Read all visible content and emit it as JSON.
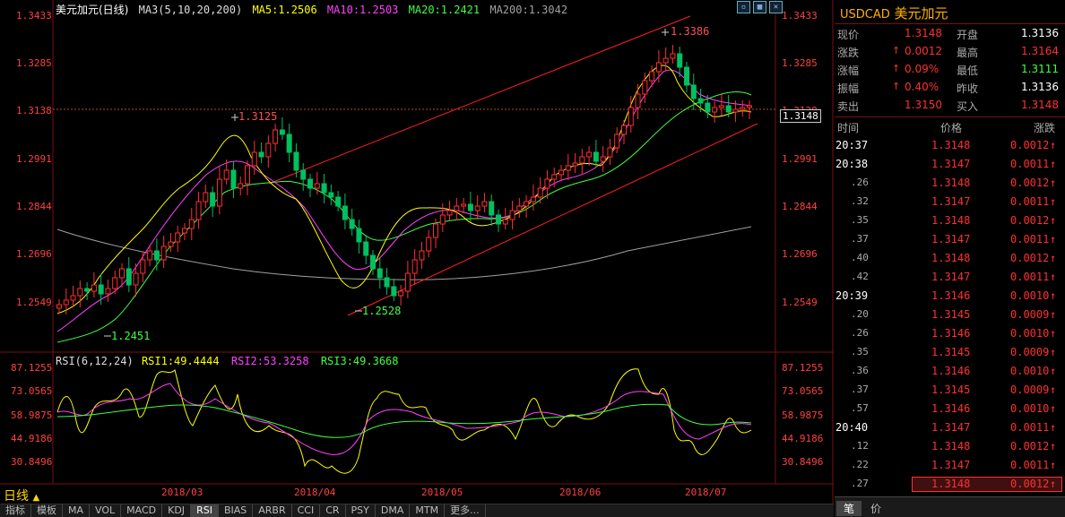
{
  "header": {
    "symbol_title": "美元加元(日线)",
    "ma_label": "MA3(5,10,20,200)",
    "ma5": "MA5:1.2506",
    "ma10": "MA10:1.2503",
    "ma20": "MA20:1.2421",
    "ma200": "MA200:1.3042",
    "colors": {
      "ma5": "#ffff00",
      "ma10": "#ff40ff",
      "ma20": "#40ff40",
      "ma200": "#a0a0a0"
    }
  },
  "price_axis": [
    "1.3433",
    "1.3285",
    "1.3138",
    "1.2991",
    "1.2844",
    "1.2696",
    "1.2549"
  ],
  "price_marker": "1.3148",
  "annotations": {
    "high1": "1.3125",
    "high2": "1.3386",
    "low1": "1.2451",
    "low2": "1.2528"
  },
  "rsi": {
    "label": "RSI(6,12,24)",
    "rsi1": "RSI1:49.4444",
    "rsi2": "RSI2:53.3258",
    "rsi3": "RSI3:49.3668",
    "axis": [
      "87.1255",
      "73.0565",
      "58.9875",
      "44.9186",
      "30.8496"
    ]
  },
  "date_axis": [
    "2018/03",
    "2018/04",
    "2018/05",
    "2018/06",
    "2018/07"
  ],
  "period_label": "日线",
  "bottom_tabs": [
    "指标",
    "模板",
    "MA",
    "VOL",
    "MACD",
    "KDJ",
    "RSI",
    "BIAS",
    "ARBR",
    "CCI",
    "CR",
    "PSY",
    "DMA",
    "MTM",
    "更多..."
  ],
  "side_tabs": [
    "笔",
    "价"
  ],
  "quote": {
    "code": "USDCAD",
    "name": "美元加元",
    "rows": [
      {
        "l1": "现价",
        "v1": "1.3148",
        "l2": "开盘",
        "v2": "1.3136"
      },
      {
        "l1": "涨跌",
        "v1": "0.0012",
        "l2": "最高",
        "v2": "1.3164"
      },
      {
        "l1": "涨幅",
        "v1": "0.09%",
        "l2": "最低",
        "v2": "1.3111"
      },
      {
        "l1": "振幅",
        "v1": "0.40%",
        "l2": "昨收",
        "v2": "1.3136"
      },
      {
        "l1": "卖出",
        "v1": "1.3150",
        "l2": "买入",
        "v2": "1.3148"
      }
    ]
  },
  "ticks_header": {
    "time": "时间",
    "price": "价格",
    "change": "涨跌"
  },
  "ticks": [
    {
      "t": "20:37",
      "p": "1.3148",
      "c": "0.0012"
    },
    {
      "t": "20:38",
      "p": "1.3147",
      "c": "0.0011"
    },
    {
      "t": ".26",
      "p": "1.3148",
      "c": "0.0012"
    },
    {
      "t": ".32",
      "p": "1.3147",
      "c": "0.0011"
    },
    {
      "t": ".35",
      "p": "1.3148",
      "c": "0.0012"
    },
    {
      "t": ".37",
      "p": "1.3147",
      "c": "0.0011"
    },
    {
      "t": ".40",
      "p": "1.3148",
      "c": "0.0012"
    },
    {
      "t": ".42",
      "p": "1.3147",
      "c": "0.0011"
    },
    {
      "t": "20:39",
      "p": "1.3146",
      "c": "0.0010"
    },
    {
      "t": ".20",
      "p": "1.3145",
      "c": "0.0009"
    },
    {
      "t": ".26",
      "p": "1.3146",
      "c": "0.0010"
    },
    {
      "t": ".35",
      "p": "1.3145",
      "c": "0.0009"
    },
    {
      "t": ".36",
      "p": "1.3146",
      "c": "0.0010"
    },
    {
      "t": ".37",
      "p": "1.3145",
      "c": "0.0009"
    },
    {
      "t": ".57",
      "p": "1.3146",
      "c": "0.0010"
    },
    {
      "t": "20:40",
      "p": "1.3147",
      "c": "0.0011"
    },
    {
      "t": ".12",
      "p": "1.3148",
      "c": "0.0012"
    },
    {
      "t": ".22",
      "p": "1.3147",
      "c": "0.0011"
    },
    {
      "t": ".27",
      "p": "1.3148",
      "c": "0.0012"
    }
  ]
}
